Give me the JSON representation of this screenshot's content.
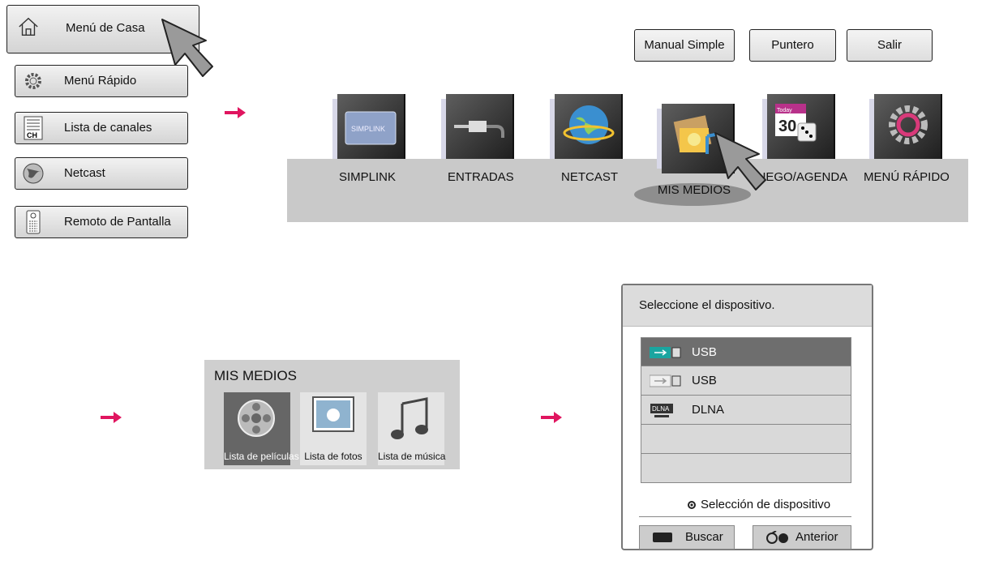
{
  "left_menu": {
    "items": [
      {
        "label": "Menú de Casa",
        "icon": "home-icon"
      },
      {
        "label": "Menú Rápido",
        "icon": "gear-icon"
      },
      {
        "label": "Lista de canales",
        "icon": "channel-list-icon"
      },
      {
        "label": "Netcast",
        "icon": "globe-icon"
      },
      {
        "label": "Remoto de Pantalla",
        "icon": "remote-icon"
      }
    ]
  },
  "top_buttons": {
    "manual": "Manual Simple",
    "pointer": "Puntero",
    "exit": "Salir"
  },
  "launcher": {
    "items": [
      {
        "label": "SIMPLINK",
        "icon": "simplink-icon"
      },
      {
        "label": "ENTRADAS",
        "icon": "inputs-icon"
      },
      {
        "label": "NETCAST",
        "icon": "globe-icon"
      },
      {
        "label": "MIS MEDIOS",
        "icon": "media-icon"
      },
      {
        "label": "JUEGO/AGENDA",
        "icon": "calendar-icon"
      },
      {
        "label": "MENÚ RÁPIDO",
        "icon": "gear-icon"
      }
    ],
    "simplink_logo": "SIMPLINK",
    "calendar_today": "Today",
    "calendar_day": "30"
  },
  "mis_medios": {
    "title": "MIS MEDIOS",
    "items": [
      {
        "label": "Lista de películas",
        "icon": "film-reel-icon"
      },
      {
        "label": "Lista de fotos",
        "icon": "photo-icon"
      },
      {
        "label": "Lista de música",
        "icon": "music-note-icon"
      }
    ]
  },
  "device_dialog": {
    "title": "Seleccione el dispositivo.",
    "devices": [
      {
        "label": "USB",
        "icon": "usb-icon"
      },
      {
        "label": "USB",
        "icon": "usb-icon"
      },
      {
        "label": "DLNA",
        "icon": "dlna-icon"
      },
      {
        "label": ""
      },
      {
        "label": ""
      }
    ],
    "dlna_badge": "DLNA",
    "hint": "Selección de dispositivo",
    "search_button": "Buscar",
    "back_button": "Anterior"
  },
  "colors": {
    "arrow": "#e0155f",
    "selected_row": "#6e6e6e",
    "bar": "#c9c9c9"
  }
}
